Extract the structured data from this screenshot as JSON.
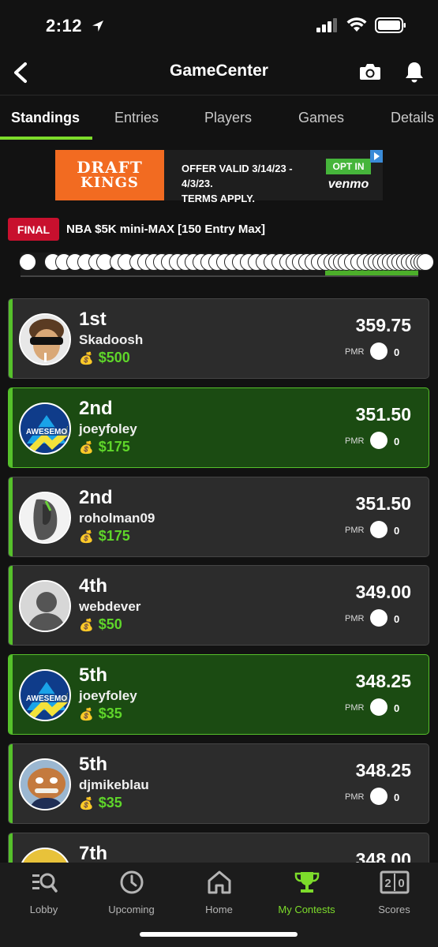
{
  "status_bar": {
    "time": "2:12"
  },
  "header": {
    "title": "GameCenter"
  },
  "tabs": [
    {
      "label": "Standings",
      "active": true
    },
    {
      "label": "Entries"
    },
    {
      "label": "Players"
    },
    {
      "label": "Games"
    },
    {
      "label": "Details"
    }
  ],
  "ad": {
    "logo_top": "DRAFT",
    "logo_bottom": "KINGS",
    "line1": "OFFER VALID 3/14/23 - 4/3/23.",
    "line2": "TERMS APPLY.",
    "opt_in": "OPT IN",
    "partner": "venmo"
  },
  "contest": {
    "status": "FINAL",
    "title": "NBA $5K mini-MAX [150 Entry Max]"
  },
  "standings": [
    {
      "rank": "1st",
      "username": "Skadoosh",
      "prize": "$500",
      "score": "359.75",
      "pmr_label": "PMR",
      "pmr": "0",
      "own": false,
      "avatar": "sunglasses-avatar"
    },
    {
      "rank": "2nd",
      "username": "joeyfoley",
      "prize": "$175",
      "score": "351.50",
      "pmr_label": "PMR",
      "pmr": "0",
      "own": true,
      "avatar": "awesemo-logo"
    },
    {
      "rank": "2nd",
      "username": "roholman09",
      "prize": "$175",
      "score": "351.50",
      "pmr_label": "PMR",
      "pmr": "0",
      "own": false,
      "avatar": "sneaker-avatar"
    },
    {
      "rank": "4th",
      "username": "webdever",
      "prize": "$50",
      "score": "349.00",
      "pmr_label": "PMR",
      "pmr": "0",
      "own": false,
      "avatar": "default-avatar"
    },
    {
      "rank": "5th",
      "username": "joeyfoley",
      "prize": "$35",
      "score": "348.25",
      "pmr_label": "PMR",
      "pmr": "0",
      "own": true,
      "avatar": "awesemo-logo"
    },
    {
      "rank": "5th",
      "username": "djmikeblau",
      "prize": "$35",
      "score": "348.25",
      "pmr_label": "PMR",
      "pmr": "0",
      "own": false,
      "avatar": "creature-avatar"
    },
    {
      "rank": "7th",
      "username": "",
      "prize": "",
      "score": "348.00",
      "pmr_label": "",
      "pmr": "",
      "own": false,
      "avatar": "yellow-avatar"
    }
  ],
  "bottom_nav": [
    {
      "label": "Lobby",
      "icon": "lobby-icon"
    },
    {
      "label": "Upcoming",
      "icon": "clock-icon"
    },
    {
      "label": "Home",
      "icon": "home-icon"
    },
    {
      "label": "My Contests",
      "icon": "trophy-icon",
      "active": true
    },
    {
      "label": "Scores",
      "icon": "scoreboard-icon",
      "badge": "20"
    }
  ],
  "colors": {
    "accent": "#7ddc2b",
    "final_badge": "#c8102e",
    "own_entry_bg": "#1b4b12",
    "ad_orange": "#f26b21"
  }
}
